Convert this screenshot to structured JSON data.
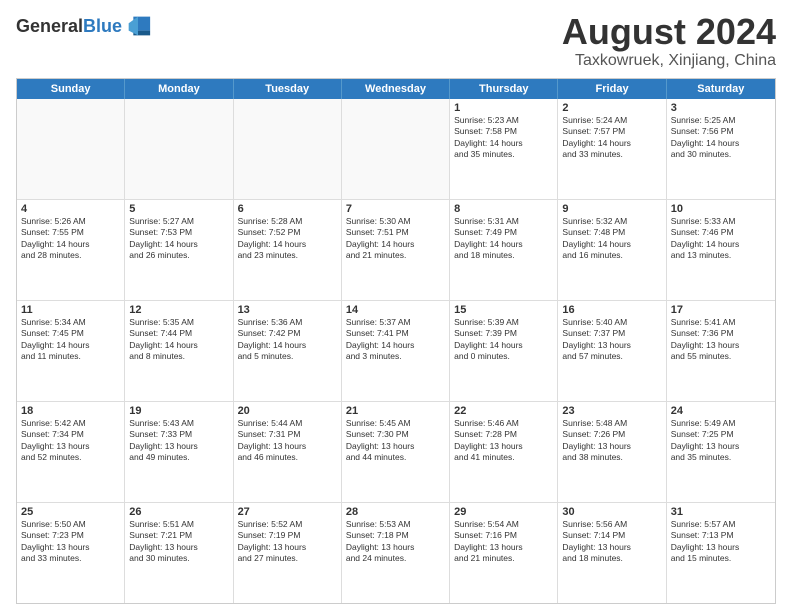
{
  "header": {
    "logo_general": "General",
    "logo_blue": "Blue",
    "month_title": "August 2024",
    "location": "Taxkowruek, Xinjiang, China"
  },
  "days_of_week": [
    "Sunday",
    "Monday",
    "Tuesday",
    "Wednesday",
    "Thursday",
    "Friday",
    "Saturday"
  ],
  "weeks": [
    [
      {
        "day": "",
        "info": "",
        "empty": true
      },
      {
        "day": "",
        "info": "",
        "empty": true
      },
      {
        "day": "",
        "info": "",
        "empty": true
      },
      {
        "day": "",
        "info": "",
        "empty": true
      },
      {
        "day": "1",
        "info": "Sunrise: 5:23 AM\nSunset: 7:58 PM\nDaylight: 14 hours\nand 35 minutes.",
        "empty": false
      },
      {
        "day": "2",
        "info": "Sunrise: 5:24 AM\nSunset: 7:57 PM\nDaylight: 14 hours\nand 33 minutes.",
        "empty": false
      },
      {
        "day": "3",
        "info": "Sunrise: 5:25 AM\nSunset: 7:56 PM\nDaylight: 14 hours\nand 30 minutes.",
        "empty": false
      }
    ],
    [
      {
        "day": "4",
        "info": "Sunrise: 5:26 AM\nSunset: 7:55 PM\nDaylight: 14 hours\nand 28 minutes.",
        "empty": false
      },
      {
        "day": "5",
        "info": "Sunrise: 5:27 AM\nSunset: 7:53 PM\nDaylight: 14 hours\nand 26 minutes.",
        "empty": false
      },
      {
        "day": "6",
        "info": "Sunrise: 5:28 AM\nSunset: 7:52 PM\nDaylight: 14 hours\nand 23 minutes.",
        "empty": false
      },
      {
        "day": "7",
        "info": "Sunrise: 5:30 AM\nSunset: 7:51 PM\nDaylight: 14 hours\nand 21 minutes.",
        "empty": false
      },
      {
        "day": "8",
        "info": "Sunrise: 5:31 AM\nSunset: 7:49 PM\nDaylight: 14 hours\nand 18 minutes.",
        "empty": false
      },
      {
        "day": "9",
        "info": "Sunrise: 5:32 AM\nSunset: 7:48 PM\nDaylight: 14 hours\nand 16 minutes.",
        "empty": false
      },
      {
        "day": "10",
        "info": "Sunrise: 5:33 AM\nSunset: 7:46 PM\nDaylight: 14 hours\nand 13 minutes.",
        "empty": false
      }
    ],
    [
      {
        "day": "11",
        "info": "Sunrise: 5:34 AM\nSunset: 7:45 PM\nDaylight: 14 hours\nand 11 minutes.",
        "empty": false
      },
      {
        "day": "12",
        "info": "Sunrise: 5:35 AM\nSunset: 7:44 PM\nDaylight: 14 hours\nand 8 minutes.",
        "empty": false
      },
      {
        "day": "13",
        "info": "Sunrise: 5:36 AM\nSunset: 7:42 PM\nDaylight: 14 hours\nand 5 minutes.",
        "empty": false
      },
      {
        "day": "14",
        "info": "Sunrise: 5:37 AM\nSunset: 7:41 PM\nDaylight: 14 hours\nand 3 minutes.",
        "empty": false
      },
      {
        "day": "15",
        "info": "Sunrise: 5:39 AM\nSunset: 7:39 PM\nDaylight: 14 hours\nand 0 minutes.",
        "empty": false
      },
      {
        "day": "16",
        "info": "Sunrise: 5:40 AM\nSunset: 7:37 PM\nDaylight: 13 hours\nand 57 minutes.",
        "empty": false
      },
      {
        "day": "17",
        "info": "Sunrise: 5:41 AM\nSunset: 7:36 PM\nDaylight: 13 hours\nand 55 minutes.",
        "empty": false
      }
    ],
    [
      {
        "day": "18",
        "info": "Sunrise: 5:42 AM\nSunset: 7:34 PM\nDaylight: 13 hours\nand 52 minutes.",
        "empty": false
      },
      {
        "day": "19",
        "info": "Sunrise: 5:43 AM\nSunset: 7:33 PM\nDaylight: 13 hours\nand 49 minutes.",
        "empty": false
      },
      {
        "day": "20",
        "info": "Sunrise: 5:44 AM\nSunset: 7:31 PM\nDaylight: 13 hours\nand 46 minutes.",
        "empty": false
      },
      {
        "day": "21",
        "info": "Sunrise: 5:45 AM\nSunset: 7:30 PM\nDaylight: 13 hours\nand 44 minutes.",
        "empty": false
      },
      {
        "day": "22",
        "info": "Sunrise: 5:46 AM\nSunset: 7:28 PM\nDaylight: 13 hours\nand 41 minutes.",
        "empty": false
      },
      {
        "day": "23",
        "info": "Sunrise: 5:48 AM\nSunset: 7:26 PM\nDaylight: 13 hours\nand 38 minutes.",
        "empty": false
      },
      {
        "day": "24",
        "info": "Sunrise: 5:49 AM\nSunset: 7:25 PM\nDaylight: 13 hours\nand 35 minutes.",
        "empty": false
      }
    ],
    [
      {
        "day": "25",
        "info": "Sunrise: 5:50 AM\nSunset: 7:23 PM\nDaylight: 13 hours\nand 33 minutes.",
        "empty": false
      },
      {
        "day": "26",
        "info": "Sunrise: 5:51 AM\nSunset: 7:21 PM\nDaylight: 13 hours\nand 30 minutes.",
        "empty": false
      },
      {
        "day": "27",
        "info": "Sunrise: 5:52 AM\nSunset: 7:19 PM\nDaylight: 13 hours\nand 27 minutes.",
        "empty": false
      },
      {
        "day": "28",
        "info": "Sunrise: 5:53 AM\nSunset: 7:18 PM\nDaylight: 13 hours\nand 24 minutes.",
        "empty": false
      },
      {
        "day": "29",
        "info": "Sunrise: 5:54 AM\nSunset: 7:16 PM\nDaylight: 13 hours\nand 21 minutes.",
        "empty": false
      },
      {
        "day": "30",
        "info": "Sunrise: 5:56 AM\nSunset: 7:14 PM\nDaylight: 13 hours\nand 18 minutes.",
        "empty": false
      },
      {
        "day": "31",
        "info": "Sunrise: 5:57 AM\nSunset: 7:13 PM\nDaylight: 13 hours\nand 15 minutes.",
        "empty": false
      }
    ]
  ]
}
